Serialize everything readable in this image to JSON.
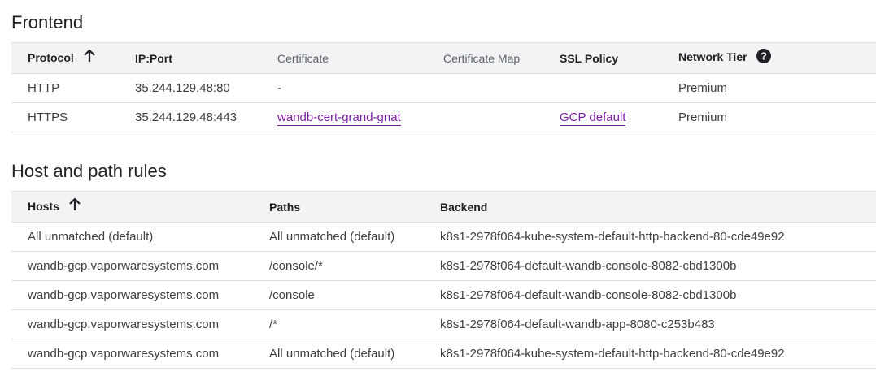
{
  "frontend": {
    "title": "Frontend",
    "columns": {
      "protocol": "Protocol",
      "ip_port": "IP:Port",
      "certificate": "Certificate",
      "certificate_map": "Certificate Map",
      "ssl_policy": "SSL Policy",
      "network_tier": "Network Tier"
    },
    "rows": [
      {
        "protocol": "HTTP",
        "ip_port": "35.244.129.48:80",
        "certificate": "-",
        "certificate_map": "",
        "ssl_policy": "",
        "network_tier": "Premium"
      },
      {
        "protocol": "HTTPS",
        "ip_port": "35.244.129.48:443",
        "certificate": "wandb-cert-grand-gnat",
        "certificate_map": "",
        "ssl_policy": "GCP default",
        "network_tier": "Premium"
      }
    ]
  },
  "host_path_rules": {
    "title": "Host and path rules",
    "columns": {
      "hosts": "Hosts",
      "paths": "Paths",
      "backend": "Backend"
    },
    "rows": [
      {
        "host": "All unmatched (default)",
        "path": "All unmatched (default)",
        "backend": "k8s1-2978f064-kube-system-default-http-backend-80-cde49e92"
      },
      {
        "host": "wandb-gcp.vaporwaresystems.com",
        "path": "/console/*",
        "backend": "k8s1-2978f064-default-wandb-console-8082-cbd1300b"
      },
      {
        "host": "wandb-gcp.vaporwaresystems.com",
        "path": "/console",
        "backend": "k8s1-2978f064-default-wandb-console-8082-cbd1300b"
      },
      {
        "host": "wandb-gcp.vaporwaresystems.com",
        "path": "/*",
        "backend": "k8s1-2978f064-default-wandb-app-8080-c253b483"
      },
      {
        "host": "wandb-gcp.vaporwaresystems.com",
        "path": "All unmatched (default)",
        "backend": "k8s1-2978f064-kube-system-default-http-backend-80-cde49e92"
      }
    ]
  },
  "colors": {
    "link": "#7b1fa2",
    "header_bg": "#f1f3f4",
    "border": "#e0e0e0"
  },
  "icons": {
    "sort": "arrow-up-icon",
    "help": "help-circle-icon"
  }
}
